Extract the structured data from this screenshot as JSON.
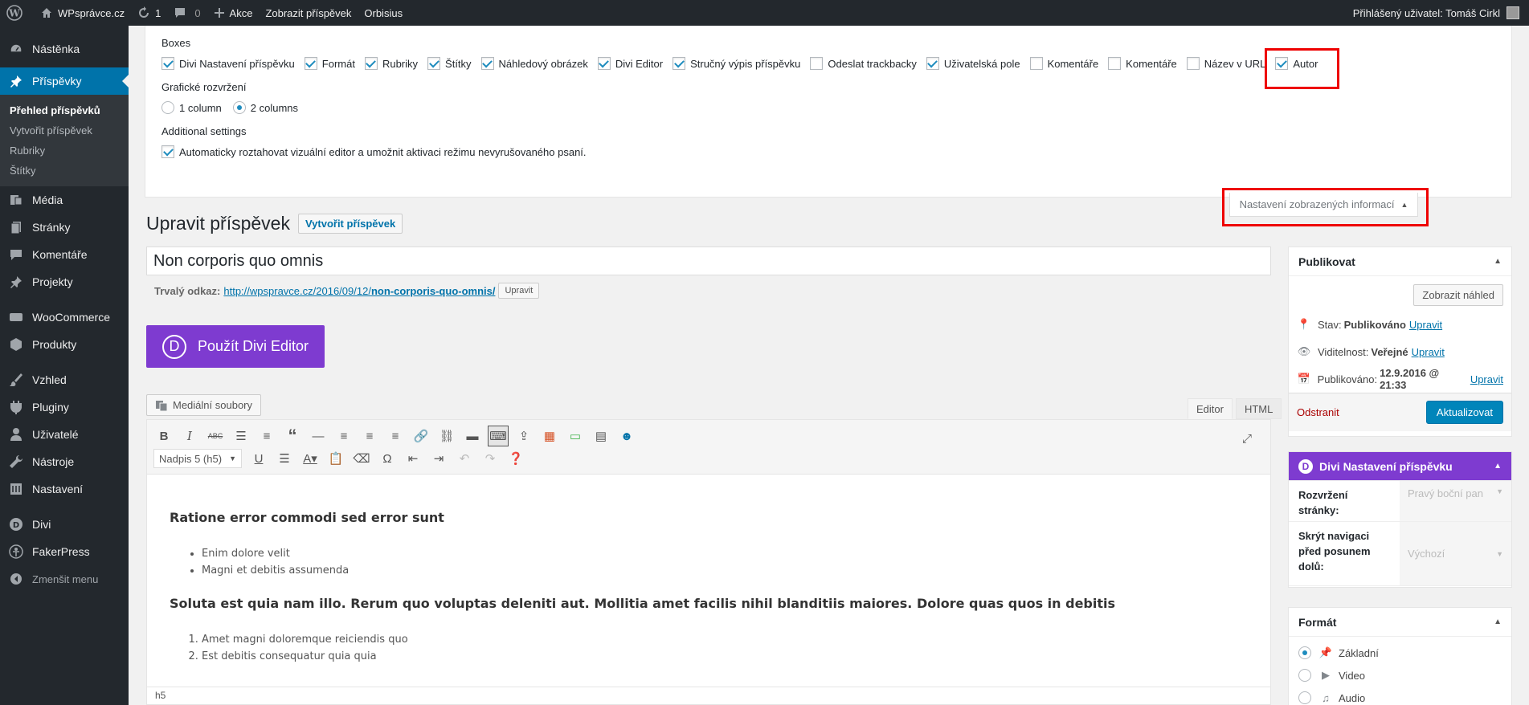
{
  "adminbar": {
    "site_name": "WPsprávce.cz",
    "updates_count": "1",
    "comments_count": "0",
    "new_label": "Akce",
    "view_post": "Zobrazit příspěvek",
    "orbisius": "Orbisius",
    "user_greeting": "Přihlášený uživatel: Tomáš Cirkl"
  },
  "sidebar": {
    "items": [
      {
        "label": "Nástěnka",
        "icon": "dashboard-icon"
      },
      {
        "label": "Příspěvky",
        "icon": "pin-icon"
      },
      {
        "label": "Média",
        "icon": "media-icon"
      },
      {
        "label": "Stránky",
        "icon": "pages-icon"
      },
      {
        "label": "Komentáře",
        "icon": "comments-icon"
      },
      {
        "label": "Projekty",
        "icon": "pin-icon"
      },
      {
        "label": "WooCommerce",
        "icon": "woo-icon"
      },
      {
        "label": "Produkty",
        "icon": "box-icon"
      },
      {
        "label": "Vzhled",
        "icon": "brush-icon"
      },
      {
        "label": "Pluginy",
        "icon": "plugin-icon"
      },
      {
        "label": "Uživatelé",
        "icon": "user-icon"
      },
      {
        "label": "Nástroje",
        "icon": "wrench-icon"
      },
      {
        "label": "Nastavení",
        "icon": "settings-icon"
      },
      {
        "label": "Divi",
        "icon": "divi-icon"
      },
      {
        "label": "FakerPress",
        "icon": "faker-icon"
      },
      {
        "label": "Zmenšit menu",
        "icon": "collapse-icon"
      }
    ],
    "submenu": [
      "Přehled příspěvků",
      "Vytvořit příspěvek",
      "Rubriky",
      "Štítky"
    ]
  },
  "screen_options": {
    "boxes_heading": "Boxes",
    "boxes": [
      {
        "label": "Divi Nastavení příspěvku",
        "checked": true
      },
      {
        "label": "Formát",
        "checked": true
      },
      {
        "label": "Rubriky",
        "checked": true
      },
      {
        "label": "Štítky",
        "checked": true
      },
      {
        "label": "Náhledový obrázek",
        "checked": true
      },
      {
        "label": "Divi Editor",
        "checked": true
      },
      {
        "label": "Stručný výpis příspěvku",
        "checked": true
      },
      {
        "label": "Odeslat trackbacky",
        "checked": false
      },
      {
        "label": "Uživatelská pole",
        "checked": true
      },
      {
        "label": "Komentáře",
        "checked": false
      },
      {
        "label": "Komentáře",
        "checked": false
      },
      {
        "label": "Název v URL",
        "checked": false
      },
      {
        "label": "Autor",
        "checked": true
      }
    ],
    "layout_heading": "Grafické rozvržení",
    "layout_1": "1 column",
    "layout_2": "2 columns",
    "additional_heading": "Additional settings",
    "additional_label": "Automaticky roztahovat vizuální editor a umožnit aktivaci režimu nevyrušovaného psaní.",
    "tab_label": "Nastavení zobrazených informací"
  },
  "editor_page": {
    "heading": "Upravit příspěvek",
    "new_button": "Vytvořit příspěvek",
    "post_title": "Non corporis quo omnis",
    "permalink_label": "Trvalý odkaz:",
    "permalink_base": "http://wpspravce.cz/2016/09/12/",
    "permalink_slug": "non-corporis-quo-omnis/",
    "permalink_edit": "Upravit",
    "divi_button": "Použít Divi Editor",
    "media_button": "Mediální soubory",
    "tab_editor": "Editor",
    "tab_html": "HTML",
    "format_select": "Nadpis 5 (h5)",
    "content": {
      "heading1": "Ratione error commodi sed error sunt",
      "list1": [
        "Enim dolore velit",
        "Magni et debitis assumenda"
      ],
      "heading2": "Soluta est quia nam illo. Rerum quo voluptas deleniti aut. Mollitia amet facilis nihil blanditiis maiores. Dolore quas quos in debitis",
      "list2": [
        "Amet magni doloremque reiciendis quo",
        "Est debitis consequatur quia quia"
      ]
    },
    "status_path": "h5"
  },
  "publish_box": {
    "title": "Publikovat",
    "preview_button": "Zobrazit náhled",
    "status_label": "Stav:",
    "status_value": "Publikováno",
    "visibility_label": "Viditelnost:",
    "visibility_value": "Veřejné",
    "published_label": "Publikováno:",
    "published_value": "12.9.2016 @ 21:33",
    "edit_link": "Upravit",
    "delete_link": "Odstranit",
    "update_button": "Aktualizovat"
  },
  "divi_box": {
    "title": "Divi Nastavení příspěvku",
    "layout_label": "Rozvržení stránky:",
    "layout_value": "Pravý boční pan",
    "nav_label": "Skrýt navigaci před posunem dolů:",
    "nav_value": "Výchozí"
  },
  "format_box": {
    "title": "Formát",
    "items": [
      {
        "label": "Základní",
        "checked": true
      },
      {
        "label": "Video",
        "checked": false
      },
      {
        "label": "Audio",
        "checked": false
      }
    ]
  }
}
